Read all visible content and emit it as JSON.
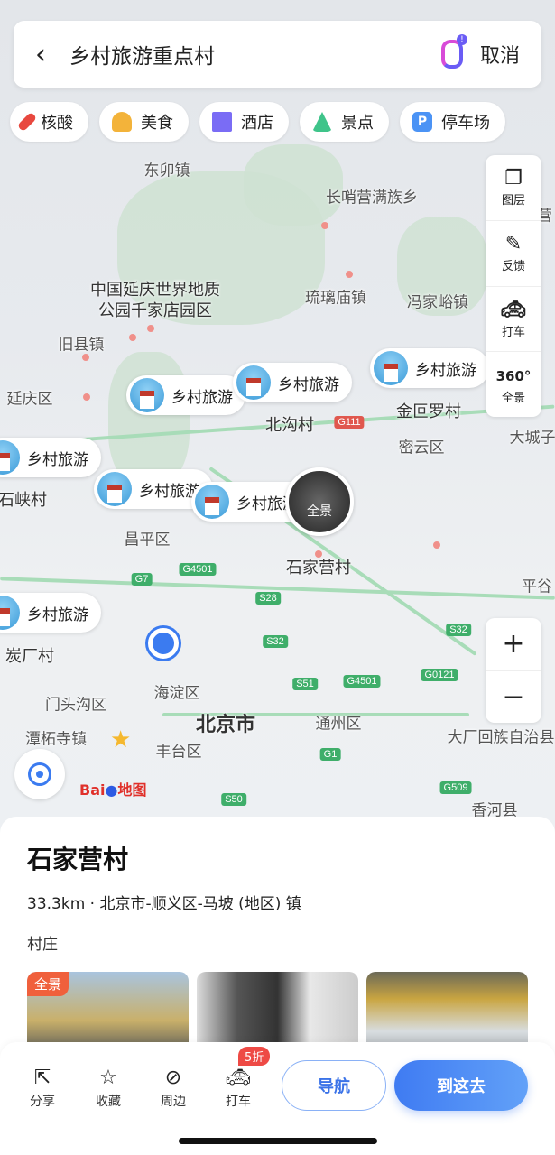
{
  "search": {
    "query": "乡村旅游重点村",
    "cancel_label": "取消"
  },
  "chips": [
    {
      "label": "核酸",
      "color": "#e8483f"
    },
    {
      "label": "美食",
      "color": "#f3b33a"
    },
    {
      "label": "酒店",
      "color": "#7a6cf5"
    },
    {
      "label": "景点",
      "color": "#3fc48a"
    },
    {
      "label": "停车场",
      "color": "#4b93f5"
    }
  ],
  "map": {
    "labels": [
      "东卯镇",
      "长哨营满族乡",
      "中国延庆世界地质",
      "公园千家店园区",
      "琉璃庙镇",
      "冯家峪镇",
      "旧县镇",
      "延庆区",
      "北沟村",
      "金叵罗村",
      "密云区",
      "大城子",
      "石峡村",
      "昌平区",
      "石家营村",
      "平谷",
      "炭厂村",
      "门头沟区",
      "海淀区",
      "北京市",
      "通州区",
      "潭柘寺镇",
      "丰台区",
      "大厂回族自治县",
      "香河县",
      "马营"
    ],
    "roads": [
      "G111",
      "G4501",
      "G7",
      "S28",
      "S32",
      "S32",
      "S51",
      "G4501",
      "G0121",
      "G1",
      "S50",
      "G509"
    ],
    "marker_label": "乡村旅游",
    "panorama_label": "全景",
    "logo": {
      "bai": "Bai",
      "du": "地图"
    }
  },
  "tools": [
    {
      "label": "图层",
      "icon": "layers-icon"
    },
    {
      "label": "反馈",
      "icon": "feedback-icon"
    },
    {
      "label": "打车",
      "icon": "taxi-icon"
    },
    {
      "label": "全景",
      "icon": "360-icon",
      "glyph": "360°"
    }
  ],
  "place": {
    "name": "石家营村",
    "address": "33.3km · 北京市-顺义区-马坡 (地区) 镇",
    "type": "村庄",
    "photo_tag": "全景"
  },
  "actions": [
    {
      "label": "分享",
      "icon": "share-icon"
    },
    {
      "label": "收藏",
      "icon": "star-icon"
    },
    {
      "label": "周边",
      "icon": "compass-icon"
    },
    {
      "label": "打车",
      "icon": "taxi-icon"
    }
  ],
  "taxi_badge": "5折",
  "nav_label": "导航",
  "go_label": "到这去"
}
